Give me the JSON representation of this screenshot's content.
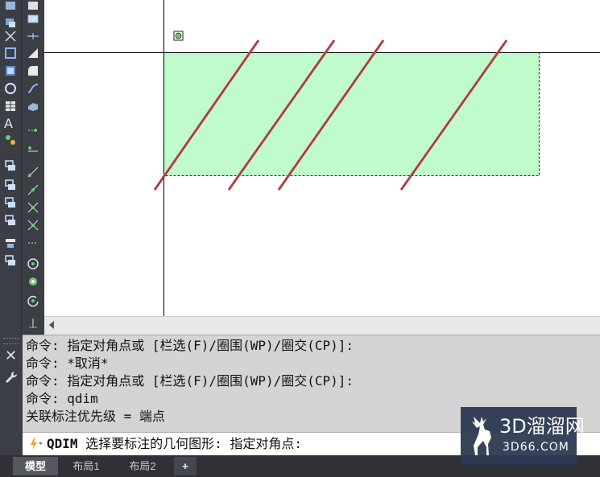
{
  "command_history": [
    "命令: 指定对角点或 [栏选(F)/圈围(WP)/圈交(CP)]:",
    "命令: *取消*",
    "命令: 指定对角点或 [栏选(F)/圈围(WP)/圈交(CP)]:",
    "命令: qdim",
    "关联标注优先级 = 端点"
  ],
  "command_prompt": {
    "command": "QDIM",
    "text": " 选择要标注的几何图形: 指定对角点:"
  },
  "tabs": [
    "模型",
    "布局1",
    "布局2",
    "+"
  ],
  "active_tab": "模型",
  "watermark": {
    "main": "3D溜溜网",
    "sub": "3D66.COM"
  },
  "colors": {
    "selection_fill": "#c0fbcb",
    "line": "#5a5a3a",
    "line_highlight": "#ff3355",
    "toolbar_bg": "#3b3e44",
    "command_bg": "#d4d4d4"
  },
  "icons": {
    "close": "close-icon",
    "settings": "wrench-icon",
    "command_marker": "command-lightning-icon"
  }
}
